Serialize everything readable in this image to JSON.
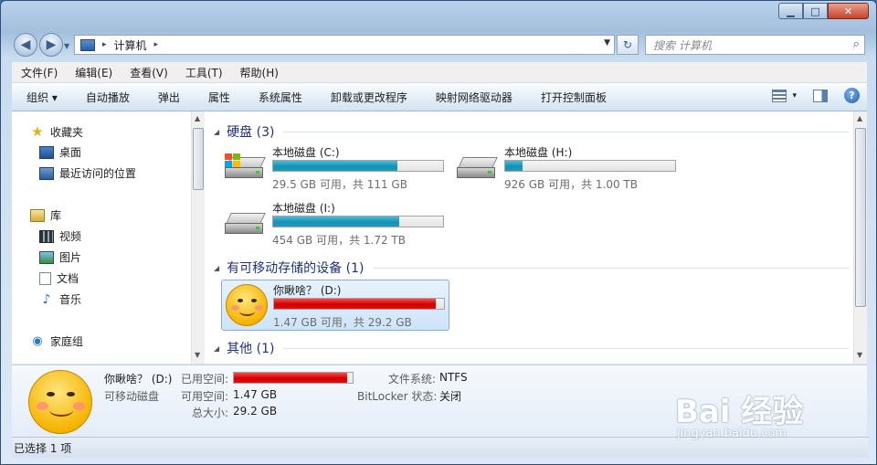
{
  "window": {
    "caption_buttons": {
      "minimize": "▁",
      "maximize": "□",
      "close": "✕"
    }
  },
  "nav": {
    "back_icon": "back-arrow-icon",
    "forward_icon": "forward-arrow-icon",
    "address": {
      "separator": "▸",
      "crumb": "计算机",
      "trail": "▸",
      "dropdown": "▼"
    },
    "refresh_glyph": "↻",
    "search_placeholder": "搜索 计算机",
    "search_icon": "⌕"
  },
  "menu": {
    "items": [
      "文件(F)",
      "编辑(E)",
      "查看(V)",
      "工具(T)",
      "帮助(H)"
    ]
  },
  "toolbar": {
    "organize": "组织 ▾",
    "commands": [
      "自动播放",
      "弹出",
      "属性",
      "系统属性",
      "卸载或更改程序",
      "映射网络驱动器",
      "打开控制面板"
    ],
    "view_dropdown": "▾",
    "help_glyph": "?"
  },
  "sidebar": {
    "favorites": {
      "label": "收藏夹",
      "items": [
        "桌面",
        "最近访问的位置"
      ]
    },
    "libraries": {
      "label": "库",
      "items": [
        "视频",
        "图片",
        "文档",
        "音乐"
      ]
    },
    "homegroup": {
      "label": "家庭组"
    }
  },
  "groups": {
    "hard_disks": {
      "header": "硬盘 (3)",
      "drives": [
        {
          "name": "本地磁盘 (C:)",
          "free": "29.5 GB 可用，共 111 GB",
          "used_fraction": 0.73,
          "system": true
        },
        {
          "name": "本地磁盘 (H:)",
          "free": "926 GB 可用，共 1.00 TB",
          "used_fraction": 0.1,
          "system": false
        },
        {
          "name": "本地磁盘 (I:)",
          "free": "454 GB 可用，共 1.72 TB",
          "used_fraction": 0.74,
          "system": false
        }
      ]
    },
    "removable": {
      "header": "有可移动存储的设备 (1)",
      "drive": {
        "name": "你瞅啥？ (D:)",
        "free": "1.47 GB 可用，共 29.2 GB",
        "used_fraction": 0.95
      }
    },
    "other": {
      "header": "其他 (1)"
    }
  },
  "details": {
    "name": "你瞅啥？ (D:)",
    "type": "可移动磁盘",
    "used_label": "已用空间:",
    "used_fraction": 0.95,
    "free_label": "可用空间:",
    "free_value": "1.47 GB",
    "total_label": "总大小:",
    "total_value": "29.2 GB",
    "fs_label": "文件系统:",
    "fs_value": "NTFS",
    "bitlocker_label": "BitLocker 状态:",
    "bitlocker_value": "关闭"
  },
  "status": {
    "text": "已选择 1 项"
  },
  "watermark": {
    "brand": "Bai  经验",
    "url": "jingyan.baidu.com"
  },
  "colors": {
    "usage_bar": "#1a8fb3",
    "usage_bar_full": "#d10000",
    "group_header": "#1e3287"
  }
}
